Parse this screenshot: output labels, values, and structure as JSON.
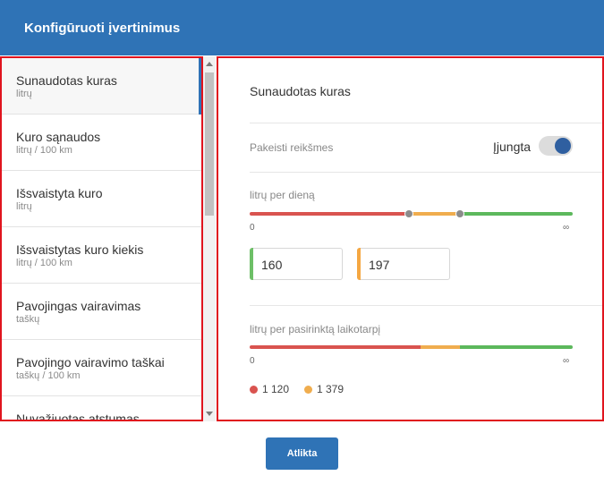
{
  "dialog": {
    "title": "Konfigūruoti įvertinimus",
    "done_label": "Atlikta"
  },
  "list": {
    "items": [
      {
        "name": "Sunaudotas kuras",
        "unit": "litrų",
        "selected": true
      },
      {
        "name": "Kuro sąnaudos",
        "unit": "litrų / 100 km"
      },
      {
        "name": "Išsvaistyta kuro",
        "unit": "litrų"
      },
      {
        "name": "Išsvaistytas kuro kiekis",
        "unit": "litrų / 100 km"
      },
      {
        "name": "Pavojingas vairavimas",
        "unit": "taškų"
      },
      {
        "name": "Pavojingo vairavimo taškai",
        "unit": "taškų / 100 km"
      },
      {
        "name": "Nuvažiuotas atstumas",
        "unit": ""
      }
    ]
  },
  "detail": {
    "title": "Sunaudotas kuras",
    "override_label": "Pakeisti reikšmes",
    "toggle_label": "Įjungta",
    "toggle_on": true,
    "per_day": {
      "label": "litrų per dieną",
      "min_label": "0",
      "max_label": "∞",
      "threshold_low": "160",
      "threshold_high": "197"
    },
    "per_period": {
      "label": "litrų per pasirinktą laikotarpį",
      "min_label": "0",
      "max_label": "∞",
      "threshold_low": "1 120",
      "threshold_high": "1 379"
    }
  },
  "colors": {
    "header": "#2f73b6",
    "red": "#d9534f",
    "orange": "#f0ad4e",
    "green": "#5cb85c",
    "accent_green": "#6dbf67",
    "accent_orange": "#f5a742"
  }
}
